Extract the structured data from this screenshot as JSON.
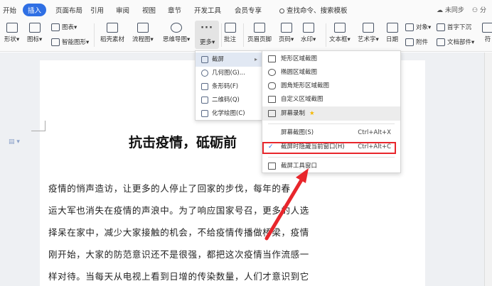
{
  "tabbar": {
    "tabs": [
      "开始",
      "插入",
      "页面布局",
      "引用",
      "审阅",
      "视图",
      "章节",
      "开发工具",
      "会员专享"
    ],
    "active_tab": "插入",
    "search_placeholder": "查找命令、搜索模板",
    "sync_label": "未同步",
    "share_label": "分"
  },
  "toolbar": {
    "shape_label": "形状",
    "icon_label": "图标",
    "chart_label": "图表",
    "smartart_label": "智能图形",
    "stock_label": "稻壳素材",
    "flowchart_label": "流程图",
    "mindmap_label": "思维导图",
    "more_label": "更多",
    "comment_label": "批注",
    "header_footer_label": "页眉页脚",
    "page_number_label": "页码",
    "watermark_label": "水印",
    "textbox_label": "文本框",
    "wordart_label": "艺术字",
    "date_label": "日期",
    "object_label": "对象",
    "dropcap_label": "首字下沉",
    "attachment_label": "附件",
    "docparts_label": "文档部件",
    "symbol_label": "符"
  },
  "more_menu": {
    "items": [
      {
        "label": "截屏",
        "icon": "screenshot-icon"
      },
      {
        "label": "几何图(G)...",
        "icon": "geometry-icon"
      },
      {
        "label": "条形码(F)",
        "icon": "barcode-icon"
      },
      {
        "label": "二维码(Q)",
        "icon": "qrcode-icon"
      },
      {
        "label": "化学绘图(C)",
        "icon": "chemistry-icon"
      }
    ]
  },
  "screenshot_menu": {
    "rect": "矩形区域截图",
    "ellipse": "椭圆区域截图",
    "rounded": "圆角矩形区域截图",
    "custom": "自定义区域截图",
    "record": "屏幕录制",
    "screen": "屏幕截图(S)",
    "screen_shortcut": "Ctrl+Alt+X",
    "hide_window": "截屏时隐藏当前窗口(H)",
    "hide_shortcut": "Ctrl+Alt+C",
    "toolbar_window": "截屏工具窗口"
  },
  "document": {
    "title": "抗击疫情，砥砺前",
    "lines": [
      "疫情的悄声造访，让更多的人停止了回家的步伐，每年的春",
      "运大军也消失在疫情的声浪中。为了响应国家号召，更多的人选",
      "择呆在家中，减少大家接触的机会，不给疫情传播做桥梁，疫情",
      "刚开始，大家的防范意识还不是很强，都把这次疫情当作流感一",
      "样对待。当每天从电视上看到日增的传染数量，人们才意识到它"
    ]
  },
  "colors": {
    "accent": "#2f6fe4",
    "highlight_box": "#e8262c",
    "star": "#f5b800"
  }
}
